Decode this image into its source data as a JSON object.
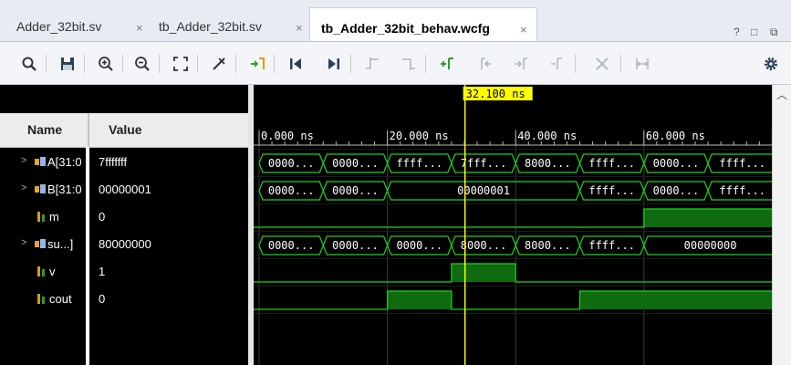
{
  "tabs": [
    {
      "label": "Adder_32bit.sv",
      "close": "×"
    },
    {
      "label": "tb_Adder_32bit.sv",
      "close": "×"
    },
    {
      "label": "tb_Adder_32bit_behav.wcfg",
      "close": "×",
      "active": true
    }
  ],
  "window_controls": [
    "?",
    "□",
    "⧉"
  ],
  "toolbar_icons": [
    "search-icon",
    "save-icon",
    "zoom-in-icon",
    "zoom-out-icon",
    "zoom-fit-icon",
    "cursor-to-zoom-icon",
    "go-to-time-zero-icon",
    "go-to-first-icon",
    "go-to-last-icon",
    "previous-transition-icon",
    "next-transition-icon",
    "add-marker-icon",
    "previous-marker-icon",
    "next-marker-icon",
    "delete-marker-icon",
    "delete-icon",
    "swap-cursors-icon",
    "settings-gear-icon"
  ],
  "columns": {
    "name": "Name",
    "value": "Value"
  },
  "cursor": {
    "label": "32.100 ns",
    "time": 32.1
  },
  "time_axis": {
    "ticks": [
      {
        "label": "0.000 ns",
        "t": 0
      },
      {
        "label": "20.000 ns",
        "t": 20
      },
      {
        "label": "40.000 ns",
        "t": 40
      },
      {
        "label": "60.000 ns",
        "t": 60
      }
    ],
    "visible_range_ns": [
      0,
      80.7
    ]
  },
  "signals": [
    {
      "name": "A[31:0]",
      "display": "A[31:0",
      "value": "7fffffff",
      "kind": "bus",
      "expandable": true
    },
    {
      "name": "B[31:0]",
      "display": "B[31:0",
      "value": "00000001",
      "kind": "bus",
      "expandable": true
    },
    {
      "name": "m",
      "display": "m",
      "value": "0",
      "kind": "bit",
      "expandable": false
    },
    {
      "name": "sum",
      "display": "su...]",
      "value": "80000000",
      "kind": "bus",
      "expandable": true
    },
    {
      "name": "v",
      "display": "v",
      "value": "1",
      "kind": "bit",
      "expandable": false
    },
    {
      "name": "cout",
      "display": "cout",
      "value": "0",
      "kind": "bit",
      "expandable": false
    }
  ],
  "waves": [
    {
      "kind": "bus",
      "segments": [
        {
          "t0": 0,
          "t1": 10,
          "label": "0000..."
        },
        {
          "t0": 10,
          "t1": 20,
          "label": "0000..."
        },
        {
          "t0": 20,
          "t1": 30,
          "label": "ffff..."
        },
        {
          "t0": 30,
          "t1": 40,
          "label": "7fff..."
        },
        {
          "t0": 40,
          "t1": 50,
          "label": "8000..."
        },
        {
          "t0": 50,
          "t1": 60,
          "label": "ffff..."
        },
        {
          "t0": 60,
          "t1": 70,
          "label": "0000..."
        },
        {
          "t0": 70,
          "t1": 80.7,
          "label": "ffff..."
        }
      ]
    },
    {
      "kind": "bus",
      "segments": [
        {
          "t0": 0,
          "t1": 10,
          "label": "0000..."
        },
        {
          "t0": 10,
          "t1": 20,
          "label": "0000..."
        },
        {
          "t0": 20,
          "t1": 50,
          "label": "00000001"
        },
        {
          "t0": 50,
          "t1": 60,
          "label": "ffff..."
        },
        {
          "t0": 60,
          "t1": 70,
          "label": "0000..."
        },
        {
          "t0": 70,
          "t1": 80.7,
          "label": "ffff..."
        }
      ]
    },
    {
      "kind": "bit",
      "high": [
        [
          60,
          80.7
        ]
      ]
    },
    {
      "kind": "bus",
      "segments": [
        {
          "t0": 0,
          "t1": 10,
          "label": "0000..."
        },
        {
          "t0": 10,
          "t1": 20,
          "label": "0000..."
        },
        {
          "t0": 20,
          "t1": 30,
          "label": "0000..."
        },
        {
          "t0": 30,
          "t1": 40,
          "label": "8000..."
        },
        {
          "t0": 40,
          "t1": 50,
          "label": "8000..."
        },
        {
          "t0": 50,
          "t1": 60,
          "label": "ffff..."
        },
        {
          "t0": 60,
          "t1": 80.7,
          "label": "00000000"
        }
      ]
    },
    {
      "kind": "bit",
      "high": [
        [
          30,
          40
        ]
      ]
    },
    {
      "kind": "bit",
      "high": [
        [
          20,
          30
        ],
        [
          50,
          80.7
        ]
      ]
    }
  ],
  "colors": {
    "wave": "#1fd11f",
    "wave_fill": "#0f6b0f",
    "cursor": "#ffff00",
    "text": "#ffffff",
    "grid": "#3a3a3a"
  }
}
